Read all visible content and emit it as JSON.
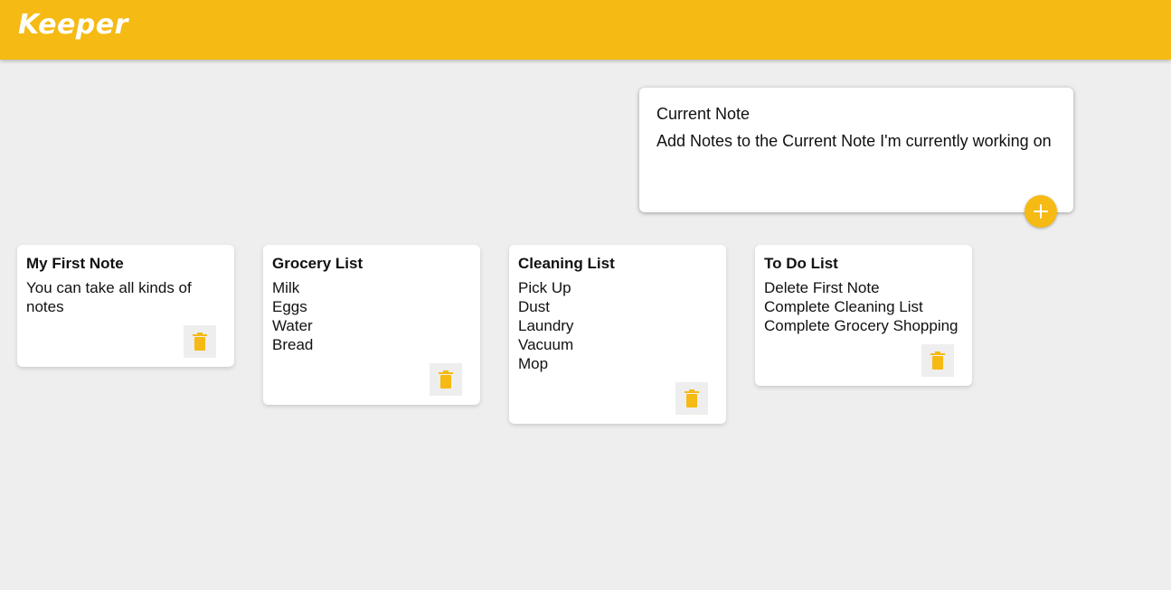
{
  "app": {
    "title": "Keeper"
  },
  "create_note": {
    "title_value": "Current Note",
    "content_value": "Add Notes to the Current Note I'm currently working on",
    "add_button_icon": "plus-icon"
  },
  "notes": [
    {
      "title": "My First Note",
      "content": "You can take all kinds of notes",
      "delete_icon": "trash-icon"
    },
    {
      "title": "Grocery List",
      "content": "Milk\nEggs\nWater\nBread",
      "delete_icon": "trash-icon"
    },
    {
      "title": "Cleaning List",
      "content": "Pick Up\nDust\nLaundry\nVacuum\nMop",
      "delete_icon": "trash-icon"
    },
    {
      "title": "To Do List",
      "content": "Delete First Note\nComplete Cleaning List\nComplete Grocery Shopping",
      "delete_icon": "trash-icon"
    }
  ],
  "colors": {
    "accent": "#f5ba13",
    "background": "#eeeeee",
    "card": "#ffffff"
  }
}
